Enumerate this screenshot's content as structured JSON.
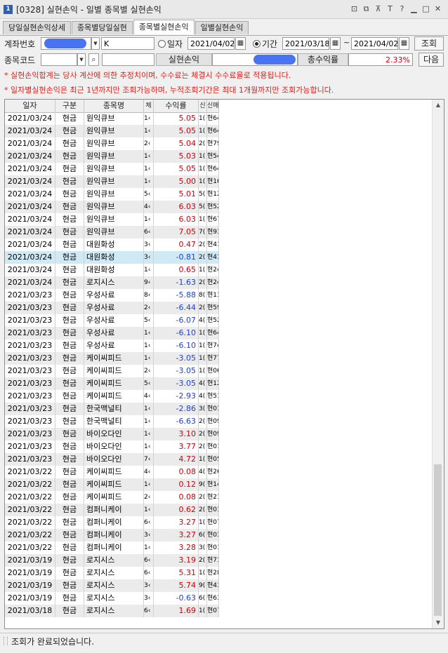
{
  "window": {
    "badge": "1",
    "title": "[0328] 실현손익 - 일별 종목별 실현손익",
    "buttons": [
      "⊡",
      "⧉",
      "⊼",
      "T",
      "?",
      "▁",
      "□",
      "✕"
    ]
  },
  "tabs": [
    "당일실현손익상세",
    "종목별당일실현",
    "종목별실현손익",
    "일별실현손익"
  ],
  "active_tab": 2,
  "form": {
    "account_label": "계좌번호",
    "account_suffix": "K",
    "daily_label": "일자",
    "daily_date": "2021/04/02",
    "period_label": "기간",
    "period_from": "2021/03/18",
    "period_sep": "~",
    "period_to": "2021/04/02",
    "query_button": "조회",
    "stock_code_label": "종목코드",
    "realized_label": "실현손익",
    "total_return_label": "총수익률",
    "total_return_value": "2.33%",
    "next_button": "다음"
  },
  "notes": [
    "* 실현손익합계는 당사 계산에 의한 추정치이며, 수수료는 체결시 수수료율로 적용됩니다.",
    "* 일자별실현손익은 최근 1년까지만 조회가능하며, 누적조회기간은 최대 1개월까지만 조회가능합니다."
  ],
  "grid": {
    "headers": [
      "일자",
      "구분",
      "종목명",
      "체",
      "수익률",
      "신",
      "신매"
    ],
    "rows": [
      [
        "2021/03/24",
        "현금",
        "원익큐브",
        "1‹",
        "5.05",
        "1(",
        "현64"
      ],
      [
        "2021/03/24",
        "현금",
        "원익큐브",
        "1‹",
        "5.05",
        "1(",
        "현64"
      ],
      [
        "2021/03/24",
        "현금",
        "원익큐브",
        "2‹",
        "5.04",
        "2(",
        "현79"
      ],
      [
        "2021/03/24",
        "현금",
        "원익큐브",
        "1‹",
        "5.03",
        "1(",
        "현54"
      ],
      [
        "2021/03/24",
        "현금",
        "원익큐브",
        "1‹",
        "5.05",
        "1(",
        "현64"
      ],
      [
        "2021/03/24",
        "현금",
        "원익큐브",
        "1‹",
        "5.00",
        "1(",
        "현16"
      ],
      [
        "2021/03/24",
        "현금",
        "원익큐브",
        "5‹",
        "5.01",
        "5(",
        "현12"
      ],
      [
        "2021/03/24",
        "현금",
        "원익큐브",
        "4‹",
        "6.03",
        "5(",
        "현52"
      ],
      [
        "2021/03/24",
        "현금",
        "원익큐브",
        "1‹",
        "6.03",
        "1(",
        "현67"
      ],
      [
        "2021/03/24",
        "현금",
        "원익큐브",
        "6‹",
        "7.05",
        "7(",
        "현93"
      ],
      [
        "2021/03/24",
        "현금",
        "대원화성",
        "3‹",
        "0.47",
        "2(",
        "현41"
      ],
      [
        "2021/03/24",
        "현금",
        "대원화성",
        "3‹",
        "-0.81",
        "2(",
        "현41"
      ],
      [
        "2021/03/24",
        "현금",
        "대원화성",
        "1‹",
        "0.65",
        "1(",
        "현24"
      ],
      [
        "2021/03/24",
        "현금",
        "로지시스",
        "9‹",
        "-1.63",
        "2(",
        "현24"
      ],
      [
        "2021/03/23",
        "현금",
        "우성사료",
        "8‹",
        "-5.88",
        "8(",
        "현13"
      ],
      [
        "2021/03/23",
        "현금",
        "우성사료",
        "2‹",
        "-6.44",
        "2(",
        "현59"
      ],
      [
        "2021/03/23",
        "현금",
        "우성사료",
        "5‹",
        "-6.07",
        "4(",
        "현52"
      ],
      [
        "2021/03/23",
        "현금",
        "우성사료",
        "1‹",
        "-6.10",
        "1(",
        "현64"
      ],
      [
        "2021/03/23",
        "현금",
        "우성사료",
        "1‹",
        "-6.10",
        "1(",
        "현74"
      ],
      [
        "2021/03/23",
        "현금",
        "케이씨피드",
        "1‹",
        "-3.05",
        "1(",
        "현77"
      ],
      [
        "2021/03/23",
        "현금",
        "케이씨피드",
        "2‹",
        "-3.05",
        "1(",
        "현06"
      ],
      [
        "2021/03/23",
        "현금",
        "케이씨피드",
        "5‹",
        "-3.05",
        "4(",
        "현12"
      ],
      [
        "2021/03/23",
        "현금",
        "케이씨피드",
        "4‹",
        "-2.93",
        "4(",
        "현51"
      ],
      [
        "2021/03/23",
        "현금",
        "한국맥널티",
        "1‹",
        "-2.86",
        "3(",
        "현01"
      ],
      [
        "2021/03/23",
        "현금",
        "한국맥널티",
        "1‹",
        "-6.63",
        "2(",
        "현09"
      ],
      [
        "2021/03/23",
        "현금",
        "바이오다인",
        "1‹",
        "3.10",
        "2(",
        "현09"
      ],
      [
        "2021/03/23",
        "현금",
        "바이오다인",
        "1‹",
        "3.77",
        "2(",
        "현01"
      ],
      [
        "2021/03/23",
        "현금",
        "바이오다인",
        "7‹",
        "4.72",
        "1(",
        "현05"
      ],
      [
        "2021/03/22",
        "현금",
        "케이씨피드",
        "4‹",
        "0.08",
        "4(",
        "현26"
      ],
      [
        "2021/03/22",
        "현금",
        "케이씨피드",
        "1‹",
        "0.12",
        "9(",
        "현14"
      ],
      [
        "2021/03/22",
        "현금",
        "케이씨피드",
        "2‹",
        "0.08",
        "2(",
        "현21"
      ],
      [
        "2021/03/22",
        "현금",
        "컴퍼니케이",
        "1‹",
        "0.62",
        "2(",
        "현01"
      ],
      [
        "2021/03/22",
        "현금",
        "컴퍼니케이",
        "6‹",
        "3.27",
        "1(",
        "현07"
      ],
      [
        "2021/03/22",
        "현금",
        "컴퍼니케이",
        "3‹",
        "3.27",
        "6(",
        "현03"
      ],
      [
        "2021/03/22",
        "현금",
        "컴퍼니케이",
        "1‹",
        "3.28",
        "3(",
        "현01"
      ],
      [
        "2021/03/19",
        "현금",
        "로지시스",
        "6‹",
        "3.19",
        "2(",
        "현71"
      ],
      [
        "2021/03/19",
        "현금",
        "로지시스",
        "6‹",
        "5.31",
        "1(",
        "현28"
      ],
      [
        "2021/03/19",
        "현금",
        "로지시스",
        "3‹",
        "5.74",
        "9(",
        "현43"
      ],
      [
        "2021/03/19",
        "현금",
        "로지시스",
        "3‹",
        "-0.63",
        "6(",
        "현63"
      ],
      [
        "2021/03/18",
        "현금",
        "로지시스",
        "6‹",
        "1.69",
        "1(",
        "현07"
      ]
    ],
    "selected_row": 11
  },
  "status": {
    "text": "조회가 완료되었습니다."
  },
  "colors": {
    "positive": "#d0000a",
    "negative": "#1b3fd8",
    "notice": "#e0201b",
    "selected": "#cfe9f5"
  }
}
